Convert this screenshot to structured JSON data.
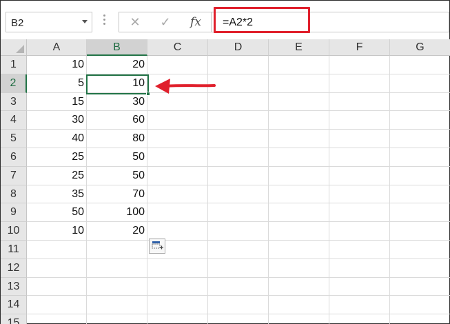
{
  "name_box": {
    "value": "B2"
  },
  "formula_bar": {
    "cancel_glyph": "✕",
    "enter_glyph": "✓",
    "fx_label": "fx",
    "formula": "=A2*2"
  },
  "columns": [
    "A",
    "B",
    "C",
    "D",
    "E",
    "F",
    "G"
  ],
  "selected_column": "B",
  "rows": [
    {
      "num": "1",
      "a": "10",
      "b": "20"
    },
    {
      "num": "2",
      "a": "5",
      "b": "10"
    },
    {
      "num": "3",
      "a": "15",
      "b": "30"
    },
    {
      "num": "4",
      "a": "30",
      "b": "60"
    },
    {
      "num": "5",
      "a": "40",
      "b": "80"
    },
    {
      "num": "6",
      "a": "25",
      "b": "50"
    },
    {
      "num": "7",
      "a": "25",
      "b": "50"
    },
    {
      "num": "8",
      "a": "35",
      "b": "70"
    },
    {
      "num": "9",
      "a": "50",
      "b": "100"
    },
    {
      "num": "10",
      "a": "10",
      "b": "20"
    },
    {
      "num": "11",
      "a": "",
      "b": ""
    },
    {
      "num": "12",
      "a": "",
      "b": ""
    },
    {
      "num": "13",
      "a": "",
      "b": ""
    },
    {
      "num": "14",
      "a": "",
      "b": ""
    },
    {
      "num": "15",
      "a": "",
      "b": ""
    }
  ],
  "selected_row": "2",
  "active_cell": "B2",
  "colors": {
    "selection": "#217346",
    "annotation": "#e0202c",
    "header_bg": "#e6e6e6"
  },
  "icons": {
    "paste_options": "paste-options-icon",
    "annotation_arrow": "red-arrow-icon"
  }
}
